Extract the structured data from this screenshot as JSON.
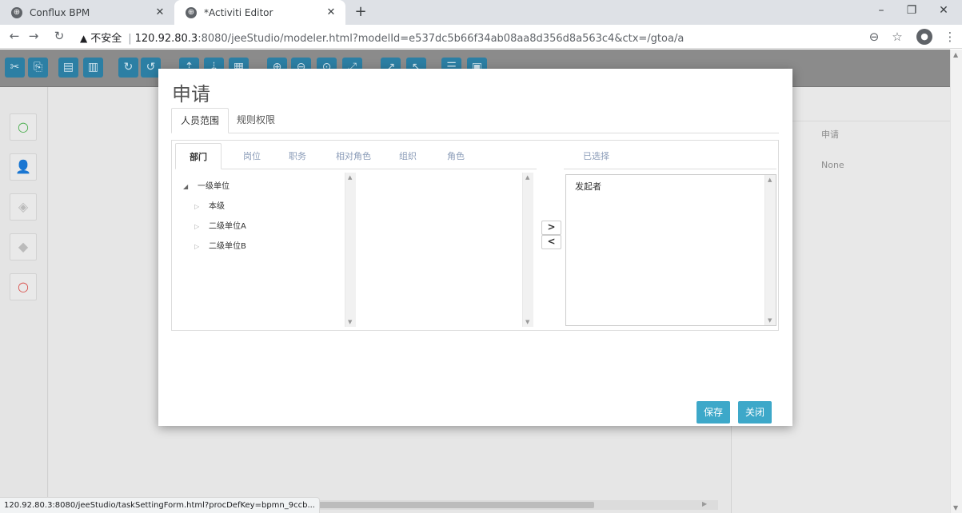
{
  "browser": {
    "tabs": [
      {
        "title": "Conflux BPM",
        "active": false
      },
      {
        "title": "*Activiti Editor",
        "active": true
      }
    ],
    "new_tab_glyph": "+",
    "window_controls": {
      "minimize": "–",
      "restore": "❐",
      "close": "✕"
    },
    "address": {
      "security_label": "不安全",
      "host": "120.92.80.3",
      "path": ":8080/jeeStudio/modeler.html?modelId=e537dc5b66f34ab08aa8d356d8a563c4&ctx=/gtoa/a"
    }
  },
  "properties_panel": {
    "values": [
      "申请",
      "None"
    ]
  },
  "dialog": {
    "title": "申请",
    "tabs": [
      {
        "label": "人员范围",
        "active": true
      },
      {
        "label": "规则权限",
        "active": false
      }
    ],
    "sub_tabs": [
      {
        "label": "部门",
        "active": true
      },
      {
        "label": "岗位",
        "active": false
      },
      {
        "label": "职务",
        "active": false
      },
      {
        "label": "相对角色",
        "active": false
      },
      {
        "label": "组织",
        "active": false
      },
      {
        "label": "角色",
        "active": false
      }
    ],
    "selected_header": "已选择",
    "tree": [
      {
        "label": "一级单位",
        "expanded": true,
        "level": 0
      },
      {
        "label": "本级",
        "expanded": false,
        "level": 1
      },
      {
        "label": "二级单位A",
        "expanded": false,
        "level": 1
      },
      {
        "label": "二级单位B",
        "expanded": false,
        "level": 1
      }
    ],
    "move_right": ">",
    "move_left": "<",
    "selected_items": [
      "发起者"
    ],
    "buttons": {
      "save": "保存",
      "close": "关闭"
    }
  },
  "status_url": "120.92.80.3:8080/jeeStudio/taskSettingForm.html?procDefKey=bpmn_9ccb...",
  "colors": {
    "primary_button": "#3da8c9",
    "toolbar_button": "#2c7fa4"
  }
}
